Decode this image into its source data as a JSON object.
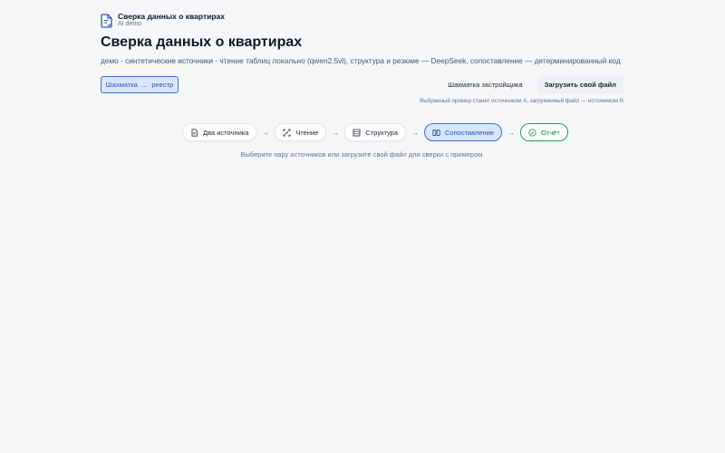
{
  "brand": {
    "title": "Сверка данных о квартирах",
    "subtitle": "AI demo",
    "icon": "document-check-icon"
  },
  "page": {
    "title": "Сверка данных о квартирах",
    "subtitle": "демо · синтетические источники · чтение таблиц локально (qwen2.5vl), структура и резюме — DeepSeek, сопоставление — детерминированный код"
  },
  "sources": {
    "a": "Шахматка",
    "b": "реестр",
    "separator": "…"
  },
  "actions": {
    "sample": "Шахматка застройщика",
    "upload": "Загрузить свой файл",
    "hint": "Выбранный пример станет источником A, загруженный файл — источником B"
  },
  "steps": [
    {
      "label": "Два источника",
      "icon": "document-icon",
      "state": "default"
    },
    {
      "label": "Чтение",
      "icon": "scan-icon",
      "state": "default"
    },
    {
      "label": "Структура",
      "icon": "table-icon",
      "state": "default"
    },
    {
      "label": "Сопоставление",
      "icon": "compare-icon",
      "state": "active"
    },
    {
      "label": "Отчёт",
      "icon": "check-circle-icon",
      "state": "done"
    }
  ],
  "arrow": "→",
  "helper": "Выберите пару источников или загрузите свой файл для сверки с примером.",
  "colors": {
    "accent": "#3b6fd4",
    "accent_bg": "#dbe6fb",
    "success": "#22a15a",
    "background": "#f6f7f9"
  }
}
